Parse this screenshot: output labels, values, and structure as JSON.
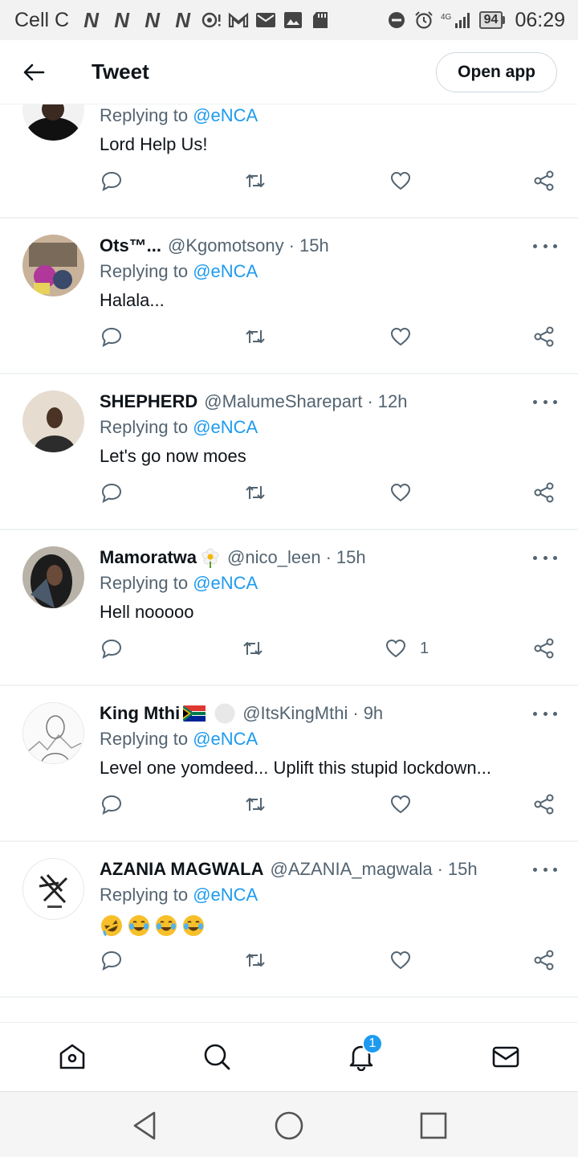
{
  "status_bar": {
    "carrier": "Cell C",
    "network_letters": [
      "N",
      "N",
      "N",
      "N"
    ],
    "network_label": "4G",
    "battery": "94",
    "time": "06:29"
  },
  "header": {
    "title": "Tweet",
    "open_app_label": "Open app"
  },
  "replying_prefix": "Replying to ",
  "replying_target": "@eNCA",
  "dot": "·",
  "tweets": [
    {
      "name": "",
      "handle": "",
      "time": "",
      "text": "Lord Help Us!",
      "likes": ""
    },
    {
      "name": "Ots™...",
      "handle": "@Kgomotsony",
      "time": "15h",
      "text": "Halala...",
      "likes": ""
    },
    {
      "name": "SHEPHERD",
      "handle": "@MalumeSharepart",
      "time": "12h",
      "text": "Let's go now moes",
      "likes": ""
    },
    {
      "name": "Mamoratwa",
      "handle": "@nico_leen",
      "time": "15h",
      "text": "Hell nooooo",
      "likes": "1"
    },
    {
      "name": "King Mthi",
      "handle": "@ItsKingMthi",
      "time": "9h",
      "text": "Level one yomdeed... Uplift this stupid lockdown...",
      "likes": ""
    },
    {
      "name": "AZANIA MAGWALA",
      "handle": "@AZANIA_magwala",
      "time": "15h",
      "text": "",
      "likes": ""
    }
  ],
  "bottom_nav": {
    "items": [
      "home-icon",
      "search-icon",
      "notifications-icon",
      "messages-icon"
    ],
    "notification_badge": "1"
  },
  "colors": {
    "accent": "#1d9bf0",
    "secondary_text": "#536471",
    "divider": "#eff3f4"
  }
}
